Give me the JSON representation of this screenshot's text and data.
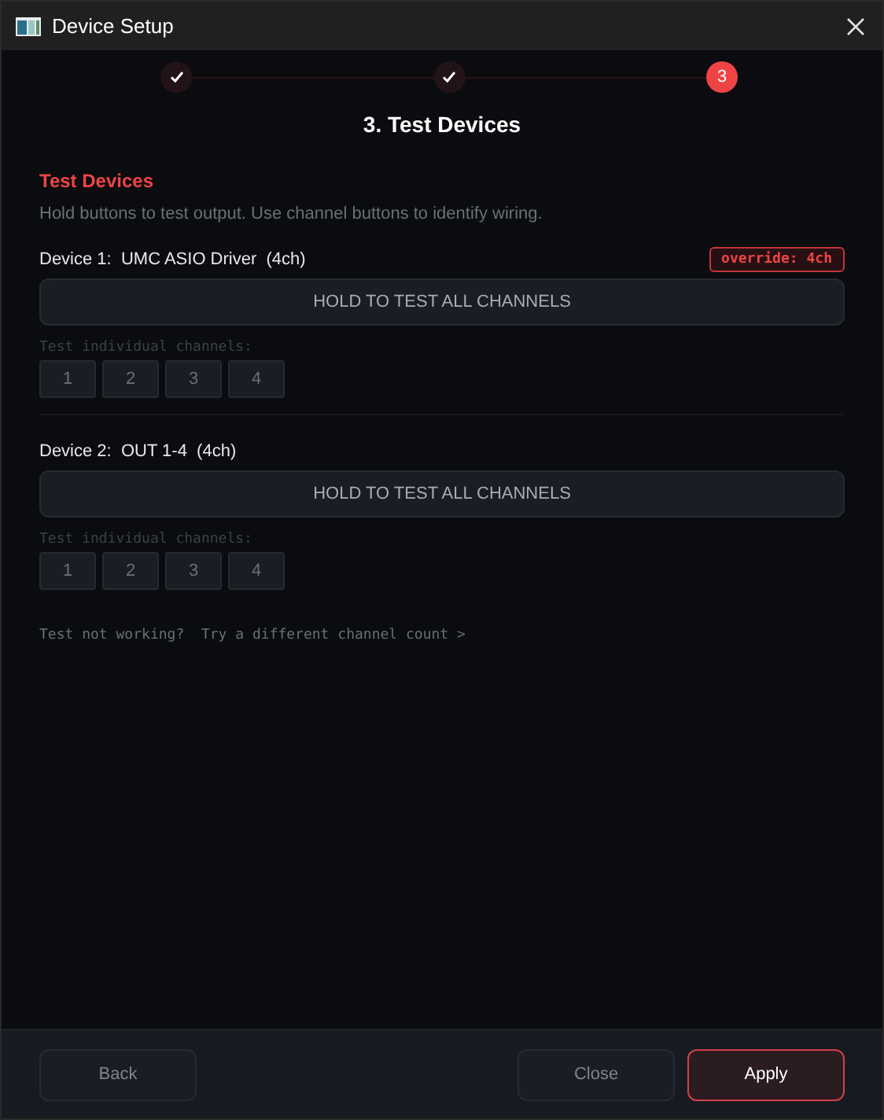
{
  "window": {
    "title": "Device Setup"
  },
  "steps": [
    {
      "done": true,
      "current": false
    },
    {
      "done": true,
      "current": false
    },
    {
      "done": false,
      "current": true,
      "label": "3"
    }
  ],
  "heading": "3. Test Devices",
  "section": {
    "title": "Test Devices",
    "description": "Hold buttons to test output. Use channel buttons to identify wiring."
  },
  "devices": [
    {
      "label": "Device 1:  UMC ASIO Driver  (4ch)",
      "override": "override: 4ch",
      "test_all": "HOLD TO TEST ALL CHANNELS",
      "channels_label": "Test individual channels:",
      "channels": [
        "1",
        "2",
        "3",
        "4"
      ]
    },
    {
      "label": "Device 2:  OUT 1-4  (4ch)",
      "test_all": "HOLD TO TEST ALL CHANNELS",
      "channels_label": "Test individual channels:",
      "channels": [
        "1",
        "2",
        "3",
        "4"
      ]
    }
  ],
  "help_link": "Test not working?  Try a different channel count >",
  "footer": {
    "back": "Back",
    "close": "Close",
    "apply": "Apply"
  }
}
